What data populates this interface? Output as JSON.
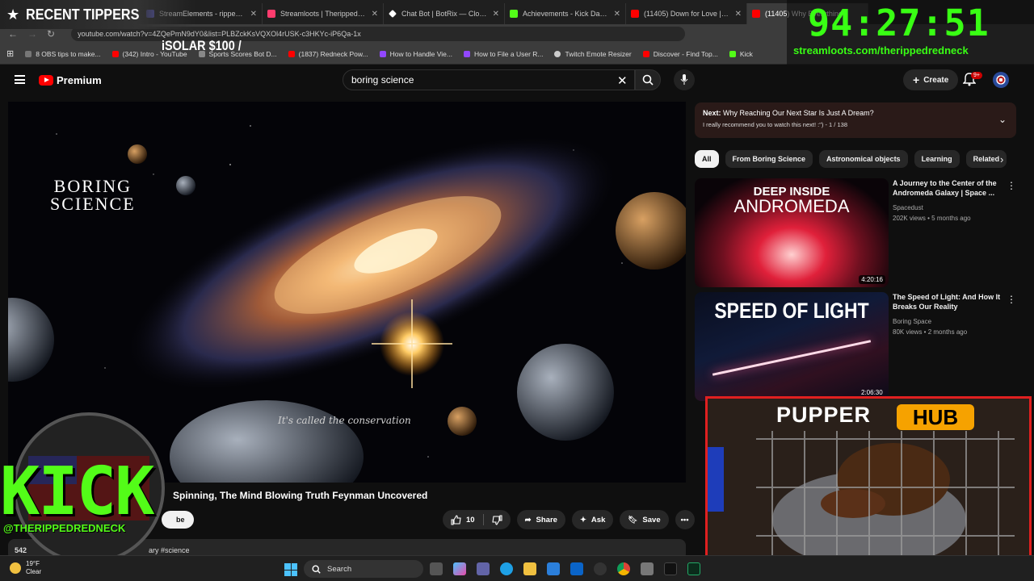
{
  "browser": {
    "tabs": [
      {
        "label": "StreamElements - rippedredn",
        "color": "#6b6bff",
        "active": false
      },
      {
        "label": "Streamloots | Therippedredn",
        "color": "#ff3c6e",
        "active": false
      },
      {
        "label": "Chat Bot | BotRix — Cloud St",
        "color": "#ffffff",
        "active": false
      },
      {
        "label": "Achievements - Kick Dashbo",
        "color": "#53fc18",
        "active": false
      },
      {
        "label": "(11405) Down for Love | Offic",
        "color": "#ff0000",
        "active": false
      },
      {
        "label": "(11405) Why Everything",
        "color": "#ff0000",
        "active": true
      }
    ],
    "url": "youtube.com/watch?v=4ZQePmN9dY0&list=PLBZckKsVQXOl4rUSK-c3HKYc-iP6Qa-1x",
    "bookmarks": [
      {
        "label": "8 OBS tips to make...",
        "color": "#777"
      },
      {
        "label": "(342) Intro - YouTube",
        "color": "#ff0000"
      },
      {
        "label": "Sports Scores Bot D...",
        "color": "#888"
      },
      {
        "label": "(1837) Redneck Pow...",
        "color": "#ff0000"
      },
      {
        "label": "How to Handle Vie...",
        "color": "#9147ff"
      },
      {
        "label": "How to File a User R...",
        "color": "#9147ff"
      },
      {
        "label": "Twitch Emote Resizer",
        "color": "#cccccc"
      },
      {
        "label": "Discover - Find Top...",
        "color": "#ff0000"
      },
      {
        "label": "Kick",
        "color": "#53fc18"
      }
    ]
  },
  "youtube": {
    "logo_text": "Premium",
    "search_value": "boring science",
    "create_label": "Create",
    "notification_count": "9+"
  },
  "video": {
    "art_title_line1": "BORING",
    "art_title_line2": "SCIENCE",
    "caption": "It's called the conservation",
    "title": "Spinning, The Mind Blowing Truth Feynman Uncovered",
    "subscribe_partial": "be",
    "likes": "10",
    "share_label": "Share",
    "ask_label": "Ask",
    "save_label": "Save",
    "desc_views": "542",
    "desc_tags": "ary #science"
  },
  "next_up": {
    "prefix": "Next:",
    "title": "Why Reaching Our Next Star Is Just A Dream?",
    "subtitle": "I really recommend you to watch this next! :\") - 1 / 138"
  },
  "chips": [
    "All",
    "From Boring Science",
    "Astronomical objects",
    "Learning",
    "Related"
  ],
  "recommendations": [
    {
      "thumb_text_1": "DEEP INSIDE",
      "thumb_text_2": "ANDROMEDA",
      "duration": "4:20:16",
      "title": "A Journey to the Center of the Andromeda Galaxy | Space ...",
      "channel": "Spacedust",
      "meta": "202K views • 5 months ago"
    },
    {
      "thumb_text_1": "SPEED OF LIGHT",
      "thumb_text_2": "",
      "duration": "2:06:30",
      "title": "The Speed of Light: And How It Breaks Our Reality",
      "channel": "Boring Space",
      "meta": "80K views • 2 months ago"
    }
  ],
  "overlays": {
    "tippers_title": "RECENT TIPPERS",
    "tip_entry": "iSOLAR $100 /",
    "timer": "94:27:51",
    "timer_url": "streamloots.com/therippedredneck",
    "kick_logo": "KICK",
    "kick_handle": "@THERIPPEDREDNECK",
    "pupper": "PUPPER",
    "hub": "HUB"
  },
  "taskbar": {
    "temp": "19°F",
    "condition": "Clear",
    "search_label": "Search"
  }
}
